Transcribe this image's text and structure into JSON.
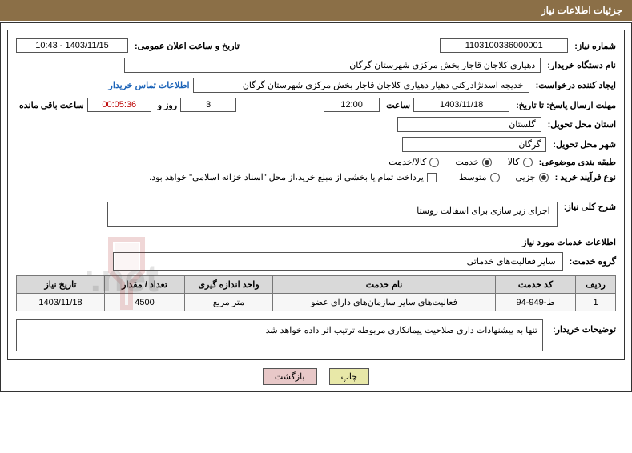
{
  "header": {
    "title": "جزئیات اطلاعات نیاز"
  },
  "fields": {
    "need_no_label": "شماره نیاز:",
    "need_no": "1103100336000001",
    "announce_dt_label": "تاریخ و ساعت اعلان عمومی:",
    "announce_dt": "1403/11/15 - 10:43",
    "buyer_org_label": "نام دستگاه خریدار:",
    "buyer_org": "دهیاری کلاجان قاجار بخش مرکزی شهرستان گرگان",
    "requester_label": "ایجاد کننده درخواست:",
    "requester": "خدیجه اسدنژادرکنی دهیار دهیاری کلاجان قاجار بخش مرکزی شهرستان گرگان",
    "buyer_contact_link": "اطلاعات تماس خریدار",
    "deadline_label": "مهلت ارسال پاسخ: تا تاریخ:",
    "deadline_date": "1403/11/18",
    "deadline_time_label": "ساعت",
    "deadline_time": "12:00",
    "days_label": "روز و",
    "days_value": "3",
    "remaining_label": "ساعت باقی مانده",
    "remaining_time": "00:05:36",
    "province_label": "استان محل تحویل:",
    "province": "گلستان",
    "city_label": "شهر محل تحویل:",
    "city": "گرگان",
    "category_label": "طبقه بندی موضوعی:",
    "cat_goods": "کالا",
    "cat_service": "خدمت",
    "cat_goods_service": "کالا/خدمت",
    "purchase_type_label": "نوع فرآیند خرید :",
    "pt_minor": "جزیی",
    "pt_medium": "متوسط",
    "payment_note": "پرداخت تمام یا بخشی از مبلغ خرید،از محل \"اسناد خزانه اسلامی\" خواهد بود.",
    "overview_label": "شرح کلی نیاز:",
    "overview_text": "اجرای زیر سازی برای اسفالت روستا",
    "services_info_label": "اطلاعات خدمات مورد نیاز",
    "service_group_label": "گروه خدمت:",
    "service_group": "سایر فعالیت‌های خدماتی"
  },
  "table": {
    "headers": {
      "row": "ردیف",
      "code": "کد خدمت",
      "name": "نام خدمت",
      "unit": "واحد اندازه گیری",
      "qty": "تعداد / مقدار",
      "date": "تاریخ نیاز"
    },
    "rows": [
      {
        "row": "1",
        "code": "ط-949-94",
        "name": "فعالیت‌های سایر سازمان‌های دارای عضو",
        "unit": "متر مربع",
        "qty": "4500",
        "date": "1403/11/18"
      }
    ]
  },
  "notes": {
    "label": "توضیحات خریدار:",
    "text": "تنها به پیشنهادات داری صلاحیت پیمانکاری مربوطه ترتیب اثر داده خواهد شد"
  },
  "buttons": {
    "print": "چاپ",
    "back": "بازگشت"
  },
  "watermark": "AriaTender.net"
}
